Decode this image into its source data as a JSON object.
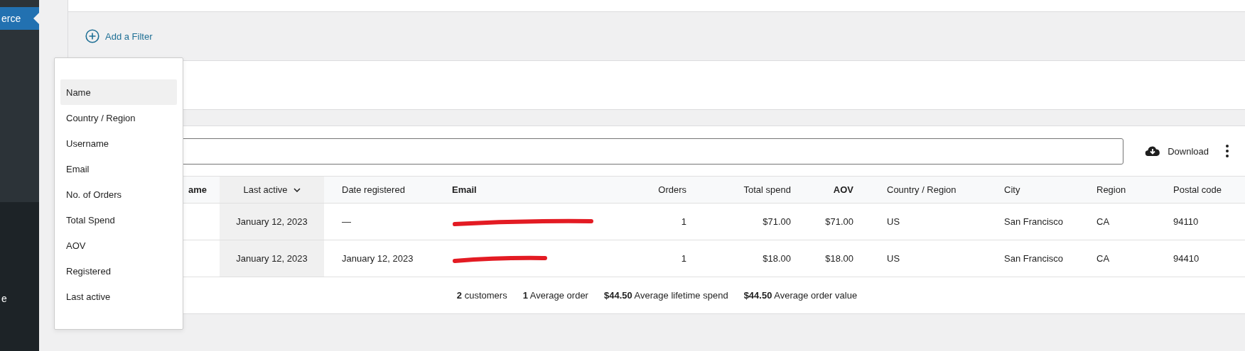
{
  "sidebar": {
    "items": [
      {
        "label": "erce",
        "selected": true
      },
      {
        "label": "e",
        "selected": false
      }
    ]
  },
  "filter": {
    "add_label": "Add a Filter"
  },
  "filter_menu": {
    "items": [
      {
        "label": "Name",
        "selected": true
      },
      {
        "label": "Country / Region",
        "selected": false
      },
      {
        "label": "Username",
        "selected": false
      },
      {
        "label": "Email",
        "selected": false
      },
      {
        "label": "No. of Orders",
        "selected": false
      },
      {
        "label": "Total Spend",
        "selected": false
      },
      {
        "label": "AOV",
        "selected": false
      },
      {
        "label": "Registered",
        "selected": false
      },
      {
        "label": "Last active",
        "selected": false
      }
    ]
  },
  "toolbar": {
    "download_label": "Download"
  },
  "table": {
    "columns": [
      {
        "label": "ame",
        "bold": true,
        "sorted": false
      },
      {
        "label": "Last active",
        "bold": false,
        "sorted": true
      },
      {
        "label": "Date registered",
        "bold": false,
        "sorted": false
      },
      {
        "label": "Email",
        "bold": true,
        "sorted": false
      },
      {
        "label": "Orders",
        "bold": false,
        "sorted": false
      },
      {
        "label": "Total spend",
        "bold": false,
        "sorted": false
      },
      {
        "label": "AOV",
        "bold": true,
        "sorted": false
      },
      {
        "label": "Country / Region",
        "bold": false,
        "sorted": false
      },
      {
        "label": "City",
        "bold": false,
        "sorted": false
      },
      {
        "label": "Region",
        "bold": false,
        "sorted": false
      },
      {
        "label": "Postal code",
        "bold": false,
        "sorted": false
      }
    ],
    "rows": [
      {
        "cells": [
          {
            "kind": "hidden"
          },
          {
            "kind": "text",
            "text": "January 12, 2023"
          },
          {
            "kind": "text",
            "text": "—"
          },
          {
            "kind": "redacted"
          },
          {
            "kind": "text",
            "text": "1"
          },
          {
            "kind": "text",
            "text": "$71.00"
          },
          {
            "kind": "text",
            "text": "$71.00"
          },
          {
            "kind": "text",
            "text": "US"
          },
          {
            "kind": "text",
            "text": "San Francisco"
          },
          {
            "kind": "text",
            "text": "CA"
          },
          {
            "kind": "text",
            "text": "94110"
          }
        ]
      },
      {
        "cells": [
          {
            "kind": "hidden"
          },
          {
            "kind": "text",
            "text": "January 12, 2023"
          },
          {
            "kind": "text",
            "text": "January 12, 2023"
          },
          {
            "kind": "redacted"
          },
          {
            "kind": "text",
            "text": "1"
          },
          {
            "kind": "text",
            "text": "$18.00"
          },
          {
            "kind": "text",
            "text": "$18.00"
          },
          {
            "kind": "text",
            "text": "US"
          },
          {
            "kind": "text",
            "text": "San Francisco"
          },
          {
            "kind": "text",
            "text": "CA"
          },
          {
            "kind": "text",
            "text": "94410"
          }
        ]
      }
    ],
    "summary": [
      "**2** customers",
      "**1** Average order",
      "**$44.50** Average lifetime spend",
      "**$44.50** Average order value"
    ]
  }
}
